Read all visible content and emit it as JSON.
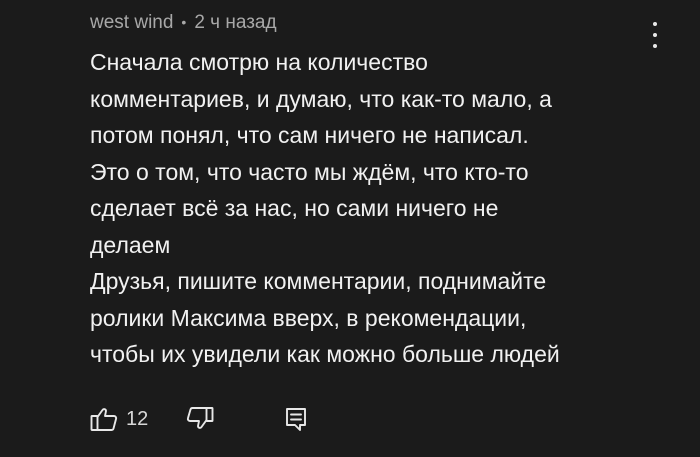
{
  "comment": {
    "author": "west wind",
    "separator": "•",
    "time": "2 ч назад",
    "lines": [
      "Сначала смотрю на количество",
      "комментариев, и думаю, что как-то мало, а",
      "потом понял, что сам ничего не написал.",
      "Это о том, что часто мы ждём, что кто-то",
      "сделает всё за нас, но сами ничего не",
      "делаем",
      "Друзья, пишите комментарии, поднимайте",
      "ролики Максима вверх, в рекомендации,",
      "чтобы их увидели как можно больше людей"
    ],
    "likes": "12"
  },
  "icons": {
    "like": "thumbs-up-icon",
    "dislike": "thumbs-down-icon",
    "reply": "comment-reply-icon",
    "menu": "more-vertical-icon"
  },
  "colors": {
    "background": "#1b1b1b",
    "text": "#f1f1f1",
    "meta": "#a8a8a8"
  }
}
